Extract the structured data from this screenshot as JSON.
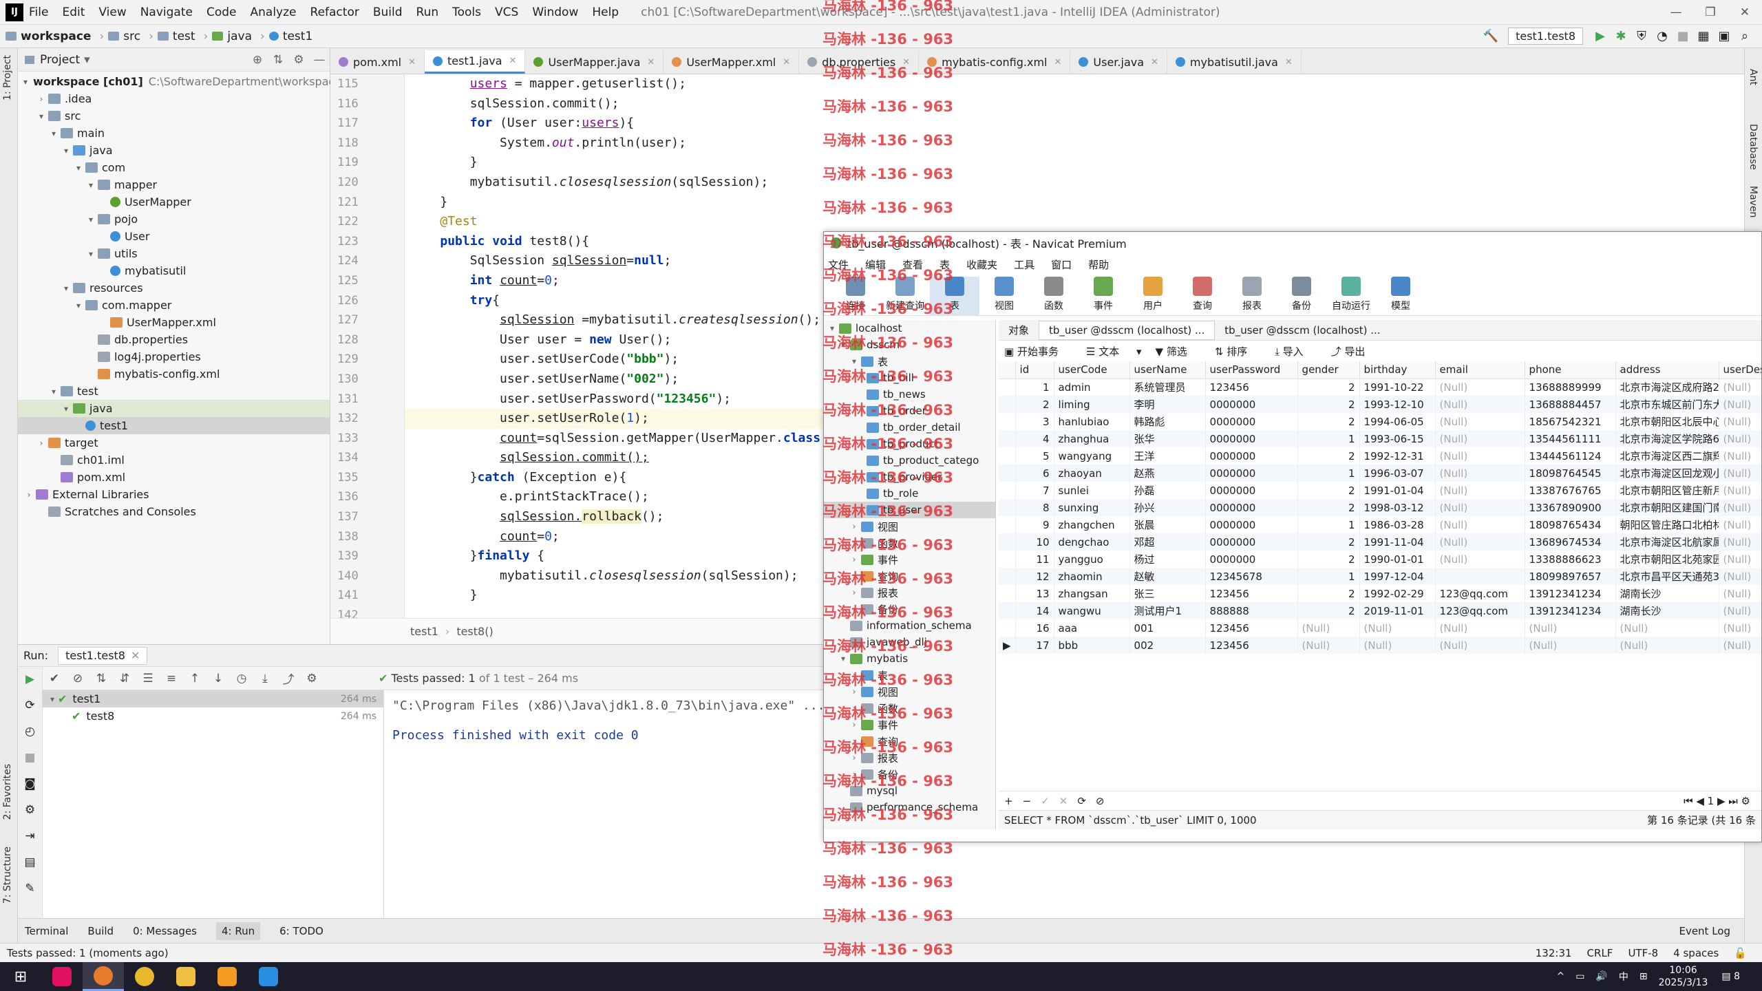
{
  "titlebar": {
    "menu": [
      "File",
      "Edit",
      "View",
      "Navigate",
      "Code",
      "Analyze",
      "Refactor",
      "Build",
      "Run",
      "Tools",
      "VCS",
      "Window",
      "Help"
    ],
    "title": "ch01 [C:\\SoftwareDepartment\\workspace] - ...\\src\\test\\java\\test1.java - IntelliJ IDEA (Administrator)"
  },
  "breadcrumb": [
    "workspace",
    "src",
    "test",
    "java",
    "test1"
  ],
  "run_config": "test1.test8",
  "project_panel": {
    "title": "Project",
    "root_label": "workspace [ch01]",
    "root_path": "C:\\SoftwareDepartment\\workspace",
    "nodes": [
      ".idea",
      "src",
      "main",
      "java",
      "com",
      "mapper",
      "UserMapper",
      "pojo",
      "User",
      "utils",
      "mybatisutil",
      "resources",
      "com.mapper",
      "UserMapper.xml",
      "db.properties",
      "log4j.properties",
      "mybatis-config.xml",
      "test",
      "java",
      "test1",
      "target",
      "ch01.iml",
      "pom.xml",
      "External Libraries",
      "Scratches and Consoles"
    ]
  },
  "editor_tabs": [
    "pom.xml",
    "test1.java",
    "UserMapper.java",
    "UserMapper.xml",
    "db.properties",
    "mybatis-config.xml",
    "User.java",
    "mybatisutil.java"
  ],
  "line_numbers": [
    "115",
    "116",
    "117",
    "118",
    "119",
    "120",
    "121",
    "122",
    "123",
    "124",
    "125",
    "126",
    "127",
    "128",
    "129",
    "130",
    "131",
    "132",
    "133",
    "134",
    "135",
    "136",
    "137",
    "138",
    "139",
    "140",
    "141",
    "142"
  ],
  "code": {
    "l115_a": "users",
    "l115_b": " = mapper.getuserlist();",
    "l116": "sqlSession.commit();",
    "l117_kw": "for",
    "l117_a": " (User user:",
    "l117_b": "users",
    "l117_c": "){",
    "l118_a": "System.",
    "l118_b": "out",
    "l118_c": ".println(user);",
    "l119": "}",
    "l120_a": "mybatisutil.",
    "l120_b": "closesqlsession",
    "l120_c": "(sqlSession);",
    "l121": "}",
    "l122": "@Test",
    "l123_kw1": "public",
    "l123_kw2": "void",
    "l123_c": " test8(){",
    "l124_a": "SqlSession ",
    "l124_b": "sqlSession",
    "l124_c": "=",
    "l124_kw": "null",
    "l124_d": ";",
    "l125_kw": "int",
    "l125_b": "count",
    "l125_c": "=",
    "l125_n": "0",
    "l125_d": ";",
    "l126_kw": "try",
    "l126_c": "{",
    "l127_a": "sqlSession",
    "l127_b": " =mybatisutil.",
    "l127_c": "createsqlsession",
    "l127_d": "();",
    "l128_a": "User user = ",
    "l128_kw": "new",
    "l128_b": " User();",
    "l129_a": "user.setUserCode(",
    "l129_s": "\"bbb\"",
    "l129_b": ");",
    "l130_a": "user.setUserName(",
    "l130_s": "\"002\"",
    "l130_b": ");",
    "l131_a": "user.setUserPassword(",
    "l131_s": "\"123456\"",
    "l131_b": ");",
    "l132_a": "user.setUserRole(",
    "l132_n": "1",
    "l132_b": ");",
    "l133_a": "count",
    "l133_b": "=sqlSession.getMapper(UserMapper.",
    "l133_kw": "class",
    "l134": "sqlSession.commit();",
    "l135_a": "}",
    "l135_kw": "catch",
    "l135_b": " (Exception e){",
    "l136": "e.printStackTrace();",
    "l137_a": "sqlSession.",
    "l137_b": "rollback",
    "l137_c": "();",
    "l138_a": "count",
    "l138_b": "=",
    "l138_n": "0",
    "l138_c": ";",
    "l139_a": "}",
    "l139_kw": "finally",
    "l139_b": " {",
    "l140_a": "mybatisutil.",
    "l140_b": "closesqlsession",
    "l140_c": "(sqlSession);",
    "l141": "}"
  },
  "editor_breadcrumb": [
    "test1",
    "test8()"
  ],
  "run_panel": {
    "label": "Run:",
    "tab": "test1.test8",
    "status_prefix": "Tests passed:",
    "status_count": "1",
    "status_suffix": "of 1 test – 264 ms",
    "tree": [
      {
        "name": "test1",
        "time": "264 ms"
      },
      {
        "name": "test8",
        "time": "264 ms"
      }
    ],
    "console_cmd": "\"C:\\Program Files (x86)\\Java\\jdk1.8.0_73\\bin\\java.exe\" ...",
    "console_exit": "Process finished with exit code 0"
  },
  "bottom_tabs": [
    "Terminal",
    "Build",
    "0: Messages",
    "4: Run",
    "6: TODO"
  ],
  "event_log": "Event Log",
  "statusbar": {
    "message": "Tests passed: 1 (moments ago)",
    "position": "132:31",
    "line_sep": "CRLF",
    "encoding": "UTF-8",
    "indent": "4 spaces"
  },
  "taskbar": {
    "time": "10:06",
    "date": "2025/3/13",
    "ime": "中",
    "notif": "8"
  },
  "side_tools": {
    "left": [
      "1: Project",
      "2: Favorites",
      "7: Structure"
    ],
    "right": [
      "Ant",
      "Database",
      "Maven"
    ]
  },
  "navicat": {
    "title": "tb_user @dsscm (localhost) - 表 - Navicat Premium",
    "menu": [
      "文件",
      "编辑",
      "查看",
      "表",
      "收藏夹",
      "工具",
      "窗口",
      "帮助"
    ],
    "toolbar": [
      "连接",
      "新建查询",
      "表",
      "视图",
      "函数",
      "事件",
      "用户",
      "查询",
      "报表",
      "备份",
      "自动运行",
      "模型"
    ],
    "tree": [
      "localhost",
      "dsscm",
      "表",
      "tb_bill",
      "tb_news",
      "tb_order",
      "tb_order_detail",
      "tb_product",
      "tb_product_catego",
      "tb_provider",
      "tb_role",
      "tb_user",
      "视图",
      "函数",
      "事件",
      "查询",
      "报表",
      "备份",
      "information_schema",
      "javaweb_dlj",
      "mybatis",
      "表",
      "视图",
      "函数",
      "事件",
      "查询",
      "报表",
      "备份",
      "mysql",
      "performance_schema"
    ],
    "tabs": [
      "对象",
      "tb_user @dsscm (localhost) ...",
      "tb_user @dsscm (localhost) ..."
    ],
    "table_toolbar": [
      "开始事务",
      "文本",
      "筛选",
      "排序",
      "导入",
      "导出"
    ],
    "columns": [
      "id",
      "userCode",
      "userName",
      "userPassword",
      "gender",
      "birthday",
      "email",
      "phone",
      "address",
      "userDesc"
    ],
    "rows": [
      [
        "1",
        "admin",
        "系统管理员",
        "123456",
        "2",
        "1991-10-22",
        "(Null)",
        "13688889999",
        "北京市海淀区成府路2(",
        "(Null)"
      ],
      [
        "2",
        "liming",
        "李明",
        "0000000",
        "2",
        "1993-12-10",
        "(Null)",
        "13688884457",
        "北京市东城区前门东大",
        "(Null)"
      ],
      [
        "3",
        "hanlubiao",
        "韩路彪",
        "0000000",
        "2",
        "1994-06-05",
        "(Null)",
        "18567542321",
        "北京市朝阳区北辰中心",
        "(Null)"
      ],
      [
        "4",
        "zhanghua",
        "张华",
        "0000000",
        "1",
        "1993-06-15",
        "(Null)",
        "13544561111",
        "北京市海淀区学院路6",
        "(Null)"
      ],
      [
        "5",
        "wangyang",
        "王洋",
        "0000000",
        "2",
        "1992-12-31",
        "(Null)",
        "13444561124",
        "北京市海淀区西二旗辉",
        "(Null)"
      ],
      [
        "6",
        "zhaoyan",
        "赵燕",
        "0000000",
        "1",
        "1996-03-07",
        "(Null)",
        "18098764545",
        "北京市海淀区回龙观小",
        "(Null)"
      ],
      [
        "7",
        "sunlei",
        "孙磊",
        "0000000",
        "2",
        "1991-01-04",
        "(Null)",
        "13387676765",
        "北京市朝阳区管庄新月",
        "(Null)"
      ],
      [
        "8",
        "sunxing",
        "孙兴",
        "0000000",
        "2",
        "1998-03-12",
        "(Null)",
        "13367890900",
        "北京市朝阳区建国门南",
        "(Null)"
      ],
      [
        "9",
        "zhangchen",
        "张晨",
        "0000000",
        "1",
        "1986-03-28",
        "(Null)",
        "18098765434",
        "朝阳区管庄路口北柏林",
        "(Null)"
      ],
      [
        "10",
        "dengchao",
        "邓超",
        "0000000",
        "2",
        "1991-11-04",
        "(Null)",
        "13689674534",
        "北京市海淀区北航家属",
        "(Null)"
      ],
      [
        "11",
        "yangguo",
        "杨过",
        "0000000",
        "2",
        "1990-01-01",
        "(Null)",
        "13388886623",
        "北京市朝阳区北苑家园",
        "(Null)"
      ],
      [
        "12",
        "zhaomin",
        "赵敏",
        "12345678",
        "1",
        "1997-12-04",
        "",
        "18099897657",
        "北京市昌平区天通苑3[",
        "(Null)"
      ],
      [
        "13",
        "zhangsan",
        "张三",
        "123456",
        "2",
        "1992-02-29",
        "123@qq.com",
        "13912341234",
        "湖南长沙",
        "(Null)"
      ],
      [
        "14",
        "wangwu",
        "测试用户1",
        "888888",
        "2",
        "2019-11-01",
        "123@qq.com",
        "13912341234",
        "湖南长沙",
        "(Null)"
      ],
      [
        "16",
        "aaa",
        "001",
        "123456",
        "(Null)",
        "(Null)",
        "(Null)",
        "(Null)",
        "(Null)",
        "(Null)"
      ],
      [
        "17",
        "bbb",
        "002",
        "123456",
        "(Null)",
        "(Null)",
        "(Null)",
        "(Null)",
        "(Null)",
        "(Null)"
      ]
    ],
    "page": "1",
    "sql": "SELECT * FROM `dsscm`.`tb_user` LIMIT 0, 1000",
    "record": "第 16 条记录 (共 16 条"
  },
  "watermark": "马海林 -136 - 963"
}
